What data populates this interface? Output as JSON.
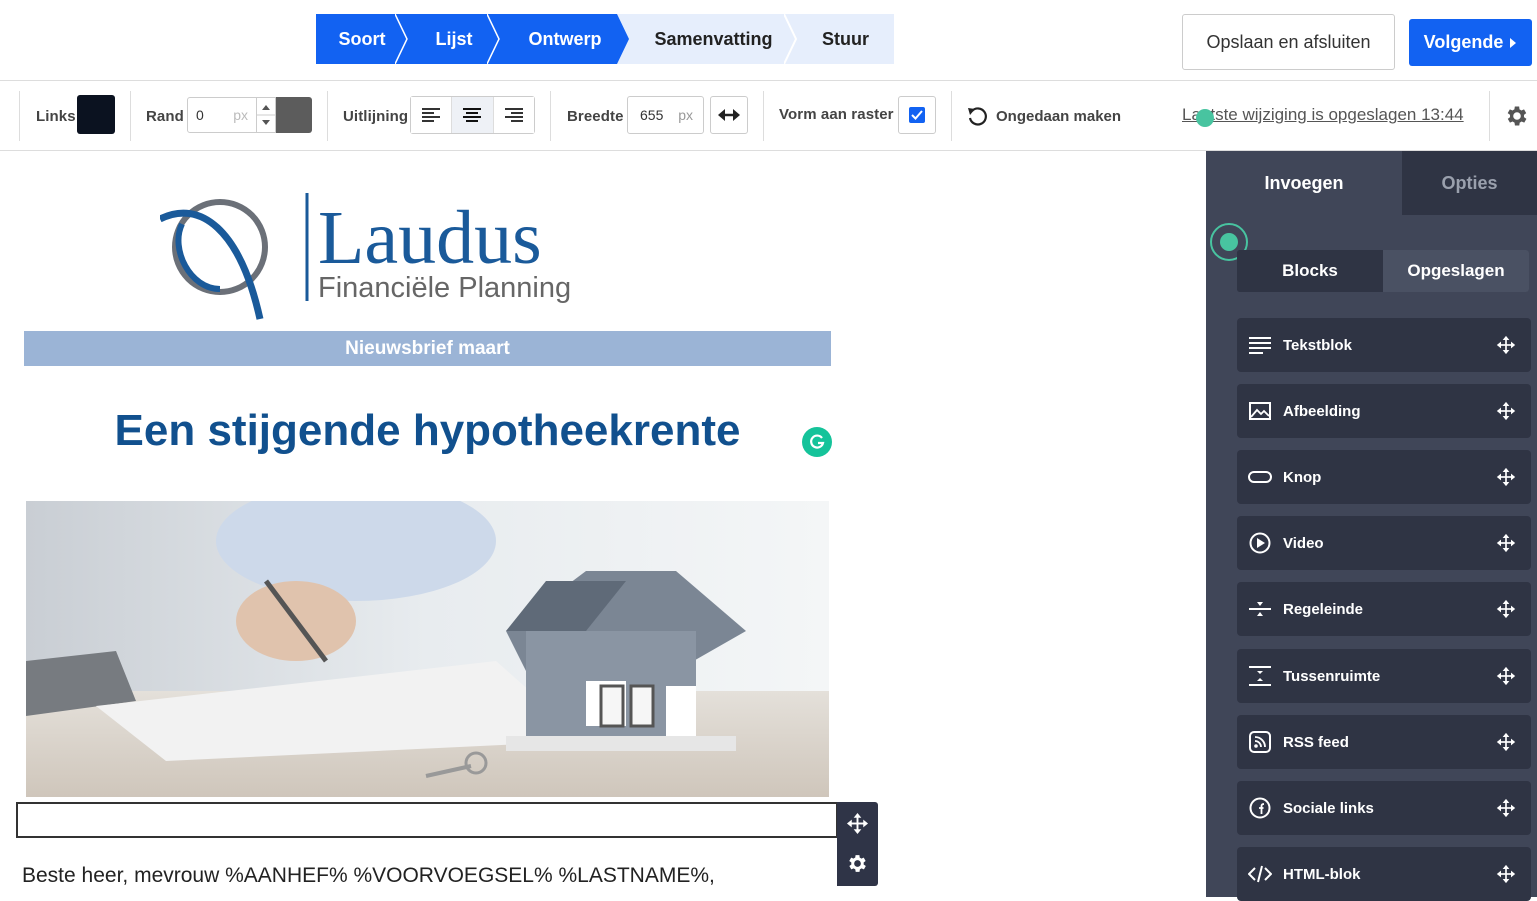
{
  "steps": [
    {
      "label": "Soort",
      "active": true
    },
    {
      "label": "Lijst",
      "active": true
    },
    {
      "label": "Ontwerp",
      "active": true
    },
    {
      "label": "Samenvatting",
      "active": false
    },
    {
      "label": "Stuur",
      "active": false
    }
  ],
  "header": {
    "save_label": "Opslaan en afsluiten",
    "next_label": "Volgende"
  },
  "toolbar": {
    "links_label": "Links",
    "rand_label": "Rand",
    "rand_value": "0",
    "rand_unit": "px",
    "align_label": "Uitlijning",
    "align_selected": "center",
    "width_label": "Breedte",
    "width_value": "655",
    "width_unit": "px",
    "grid_label": "Vorm aan raster",
    "grid_checked": true,
    "undo_label": "Ongedaan maken",
    "saved_text": "Laatste wijziging is opgeslagen 13:44",
    "links_color": "#0b1220",
    "rand_color": "#5c5c5c"
  },
  "email": {
    "logo_name": "Laudus",
    "logo_sub": "Financiële Planning",
    "banner": "Nieuwsbrief maart",
    "headline": "Een stijgende hypotheekrente",
    "greeting": "Beste heer, mevrouw %AANHEF% %VOORVOEGSEL% %LASTNAME%,",
    "hero_image": "house-model-and-contract-photo"
  },
  "panel": {
    "tabs": [
      {
        "label": "Invoegen",
        "active": true
      },
      {
        "label": "Opties",
        "active": false
      }
    ],
    "subtabs": [
      {
        "label": "Blocks",
        "active": true
      },
      {
        "label": "Opgeslagen",
        "active": false
      }
    ],
    "blocks": [
      {
        "label": "Tekstblok",
        "icon": "text-lines-icon"
      },
      {
        "label": "Afbeelding",
        "icon": "image-icon"
      },
      {
        "label": "Knop",
        "icon": "button-icon"
      },
      {
        "label": "Video",
        "icon": "play-icon"
      },
      {
        "label": "Regeleinde",
        "icon": "line-break-icon"
      },
      {
        "label": "Tussenruimte",
        "icon": "spacer-icon"
      },
      {
        "label": "RSS feed",
        "icon": "rss-icon"
      },
      {
        "label": "Sociale links",
        "icon": "facebook-icon"
      },
      {
        "label": "HTML-blok",
        "icon": "code-icon"
      }
    ]
  },
  "colors": {
    "primary": "#1262f2",
    "panel": "#404658",
    "headline": "#11508e",
    "banner": "#9bb4d6"
  }
}
